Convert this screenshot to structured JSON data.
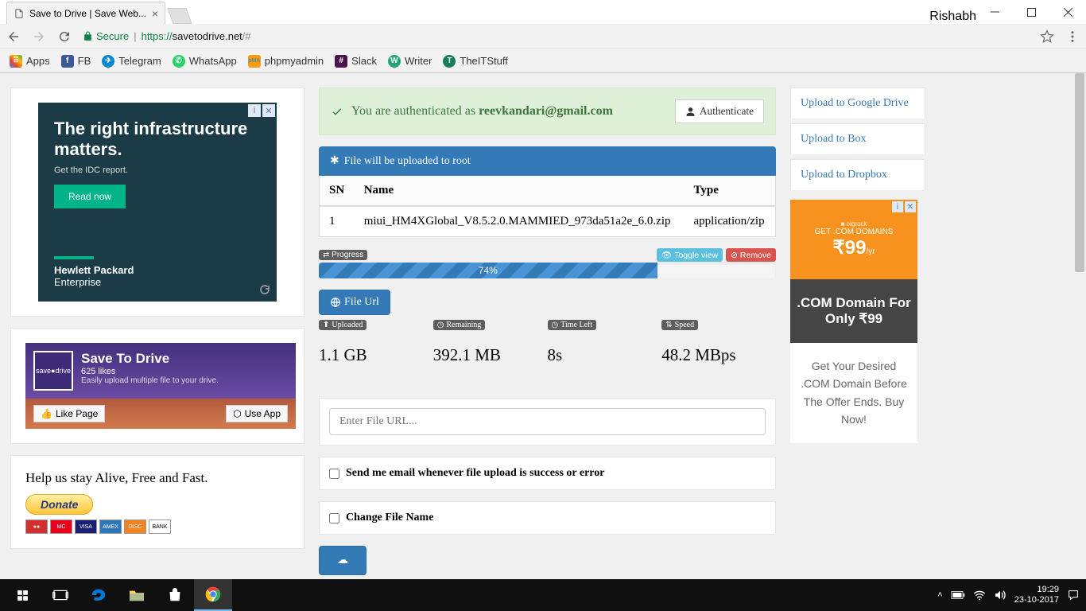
{
  "win": {
    "user": "Rishabh"
  },
  "tab": {
    "title": "Save to Drive | Save Web..."
  },
  "addr": {
    "secure": "Secure",
    "proto": "https://",
    "host": "savetodrive.net",
    "path": "/#"
  },
  "bookmarks": {
    "apps": "Apps",
    "fb": "FB",
    "telegram": "Telegram",
    "whatsapp": "WhatsApp",
    "phpmyadmin": "phpmyadmin",
    "slack": "Slack",
    "writer": "Writer",
    "theitstuff": "TheITStuff"
  },
  "ad1": {
    "title": "The right infrastructure matters.",
    "sub": "Get the IDC report.",
    "cta": "Read now",
    "brand1": "Hewlett Packard",
    "brand2": "Enterprise"
  },
  "fb": {
    "title": "Save To Drive",
    "likes": "625 likes",
    "desc": "Easily upload multiple file to your drive.",
    "like": "Like Page",
    "use": "Use App",
    "logo": "save●drive"
  },
  "help": {
    "text": "Help us stay Alive, Free and Fast.",
    "donate": "Donate"
  },
  "auth": {
    "prefix": "You are authenticated as ",
    "email": "reevkandari@gmail.com",
    "btn": "Authenticate"
  },
  "panel": {
    "title": "File will be uploaded to root"
  },
  "table": {
    "h1": "SN",
    "h2": "Name",
    "h3": "Type",
    "sn": "1",
    "name": "miui_HM4XGlobal_V8.5.2.0.MAMMIED_973da51a2e_6.0.zip",
    "type": "application/zip"
  },
  "progress": {
    "label": "Progress",
    "toggle": "Toggle view",
    "remove": "Remove",
    "pct": 74,
    "pctText": "74%"
  },
  "fileurl_btn": "File Url",
  "stats": {
    "uploaded_l": "Uploaded",
    "uploaded_v": "1.1 GB",
    "remaining_l": "Remaining",
    "remaining_v": "392.1 MB",
    "timeleft_l": "Time Left",
    "timeleft_v": "8s",
    "speed_l": "Speed",
    "speed_v": "48.2 MBps"
  },
  "url_input": {
    "placeholder": "Enter File URL..."
  },
  "chk_email": "Send me email whenever file upload is success or error",
  "chk_rename": "Change File Name",
  "side": {
    "gd": "Upload to Google Drive",
    "box": "Upload to Box",
    "dbx": "Upload to Dropbox"
  },
  "ad2": {
    "line1": "GET .COM DOMAINS",
    "price": "₹99",
    "sub": "/yr",
    "mid": ".COM Domain For Only ₹99",
    "bot": "Get Your Desired .COM Domain Before The Offer Ends. Buy Now!"
  },
  "clock": {
    "time": "19:29",
    "date": "23-10-2017"
  }
}
